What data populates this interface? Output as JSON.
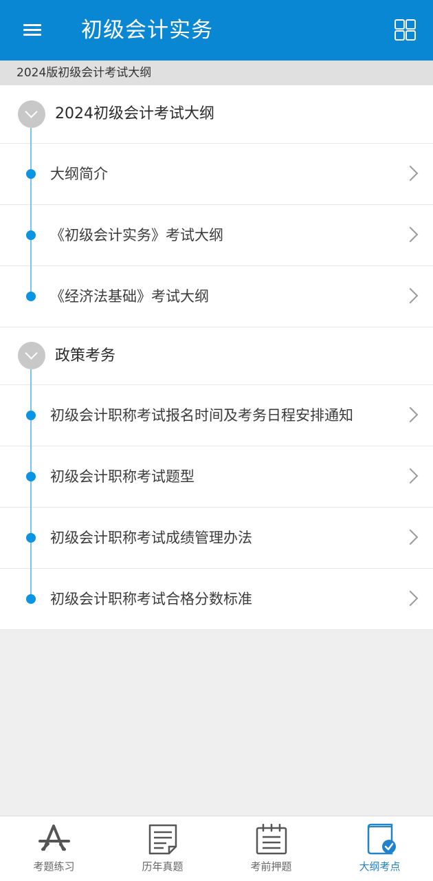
{
  "header": {
    "title": "初级会计实务",
    "menu_icon": "menu-icon",
    "grid_icon": "grid-icon"
  },
  "subheader": {
    "text": "2024版初级会计考试大纲"
  },
  "groups": [
    {
      "title": "2024初级会计考试大纲",
      "items": [
        {
          "label": "大纲简介"
        },
        {
          "label": "《初级会计实务》考试大纲"
        },
        {
          "label": "《经济法基础》考试大纲"
        }
      ]
    },
    {
      "title": "政策考务",
      "items": [
        {
          "label": "初级会计职称考试报名时间及考务日程安排通知"
        },
        {
          "label": "初级会计职称考试题型"
        },
        {
          "label": "初级会计职称考试成绩管理办法"
        },
        {
          "label": "初级会计职称考试合格分数标准"
        }
      ]
    }
  ],
  "tabbar": {
    "tabs": [
      {
        "label": "考题练习",
        "icon": "practice-icon",
        "active": false
      },
      {
        "label": "历年真题",
        "icon": "past-papers-icon",
        "active": false
      },
      {
        "label": "考前押题",
        "icon": "predicted-questions-icon",
        "active": false
      },
      {
        "label": "大纲考点",
        "icon": "syllabus-icon",
        "active": true
      }
    ],
    "active_color": "#1f82cc"
  },
  "colors": {
    "header_bg": "#0a87d2",
    "timeline_dot": "#0a95e4",
    "timeline_line": "#7cc3ea",
    "page_bg": "#efefef"
  }
}
